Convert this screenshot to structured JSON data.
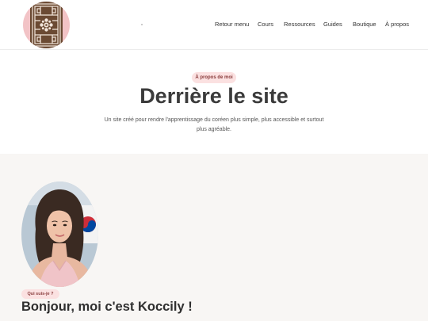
{
  "header": {
    "nav": [
      {
        "label": "Retour menu"
      },
      {
        "label": "Cours"
      },
      {
        "label": "Ressources"
      },
      {
        "label": "Guides"
      },
      {
        "label": "Boutique"
      },
      {
        "label": "À propos"
      }
    ]
  },
  "hero": {
    "badge": "À propos de moi",
    "title": "Derrière le site",
    "subtitle": "Un site créé pour rendre l'apprentissage du coréen plus simple, plus accessible et surtout plus agréable."
  },
  "about": {
    "badge": "Qui suis-je ?",
    "heading": "Bonjour, moi c'est Koccily !"
  },
  "colors": {
    "badge_bg": "#fbe1e1",
    "badge_text": "#8a3d3d",
    "section_bg": "#f8f6f4",
    "logo_brown": "#6b4a33",
    "logo_pink": "#f2c3c6"
  }
}
